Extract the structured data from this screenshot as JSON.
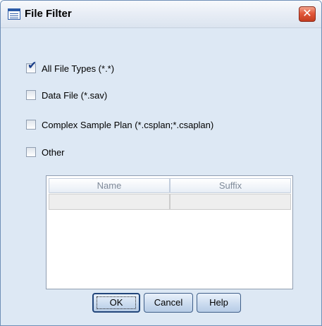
{
  "window": {
    "title": "File Filter",
    "icon": "dialog-icon",
    "close_icon": "close-icon",
    "close_glyph": "✕"
  },
  "options": [
    {
      "label": "All File Types (*.*)",
      "checked": true
    },
    {
      "label": "Data File (*.sav)",
      "checked": false
    },
    {
      "label": "Complex Sample Plan (*.csplan;*.csaplan)",
      "checked": false
    },
    {
      "label": "Other",
      "checked": false
    }
  ],
  "table": {
    "columns": [
      "Name",
      "Suffix"
    ],
    "rows": [
      [
        "",
        ""
      ]
    ]
  },
  "buttons": {
    "ok": "OK",
    "cancel": "Cancel",
    "help": "Help"
  },
  "check_glyph": "✔",
  "colors": {
    "accent": "#1b3f8a",
    "dialog_background": "#dde8f4",
    "close_button": "#d6492b"
  }
}
